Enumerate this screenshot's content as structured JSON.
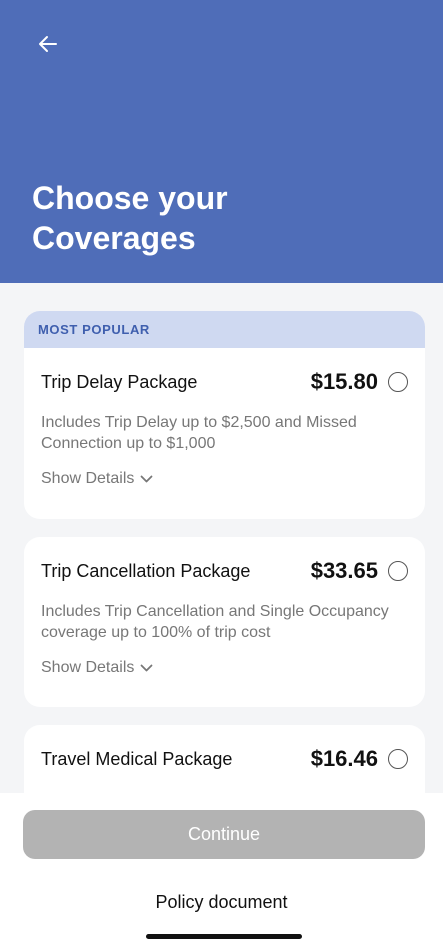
{
  "header": {
    "title_line1": "Choose your",
    "title_line2": "Coverages",
    "back_icon": "arrow-left-icon",
    "background_color": "#4f6db8"
  },
  "packages": [
    {
      "badge": "MOST POPULAR",
      "name": "Trip Delay Package",
      "price": "$15.80",
      "description": "Includes Trip Delay up to $2,500 and Missed Connection up to $1,000",
      "show_details": "Show Details"
    },
    {
      "name": "Trip Cancellation Package",
      "price": "$33.65",
      "description": "Includes Trip Cancellation and Single Occupancy coverage up to 100% of trip cost",
      "show_details": "Show Details"
    },
    {
      "name": "Travel Medical Package",
      "price": "$16.46"
    }
  ],
  "footer": {
    "continue_label": "Continue",
    "policy_label": "Policy document"
  },
  "colors": {
    "accent": "#4f6db8",
    "badge_bg": "#cfd9f1",
    "badge_text": "#3f5fae",
    "button_disabled": "#b3b3b3"
  }
}
